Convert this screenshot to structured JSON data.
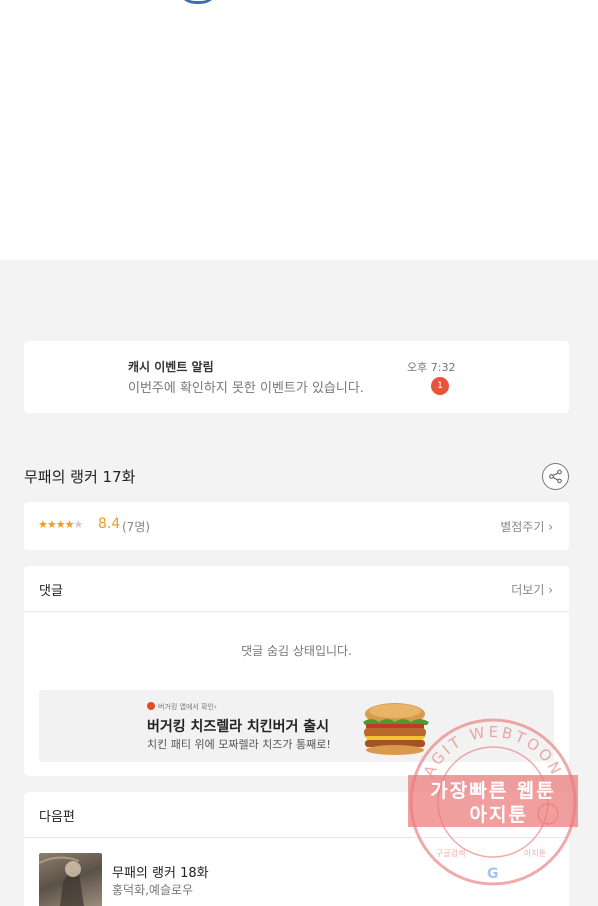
{
  "event": {
    "title": "캐시 이벤트 알림",
    "time": "오후 7:32",
    "description": "이번주에 확인하지 못한 이벤트가 있습니다.",
    "badge_count": "1"
  },
  "episode": {
    "title": "무패의 랭커 17화"
  },
  "rating": {
    "stars_filled": 4,
    "stars_total": 5,
    "score": "8.4",
    "count": "(7명)",
    "action_label": "별점주기 ›"
  },
  "comments": {
    "title": "댓글",
    "more_label": "더보기 ›",
    "hidden_message": "댓글 숨김 상태입니다."
  },
  "ad": {
    "small_text": "버거킹 앱에서 확인›",
    "title": "버거킹 치즈렐라 치킨버거 출시",
    "description": "치킨 패티 위에 모짜렐라 치즈가 통째로!"
  },
  "next_episode": {
    "section_title": "다음편",
    "title": "무패의 랭커 18화",
    "authors": "홍덕화,예슬로우"
  },
  "watermark": {
    "arc_text": "AGIT WEBTOON",
    "line1": "가장빠른 웹툰",
    "line2": "아지툰",
    "bottom_left": "구글검색",
    "bottom_right": "아지툰",
    "google_letter": "G"
  },
  "colors": {
    "accent_star": "#f29b1c",
    "badge": "#e8543a",
    "watermark": "#e77777"
  }
}
